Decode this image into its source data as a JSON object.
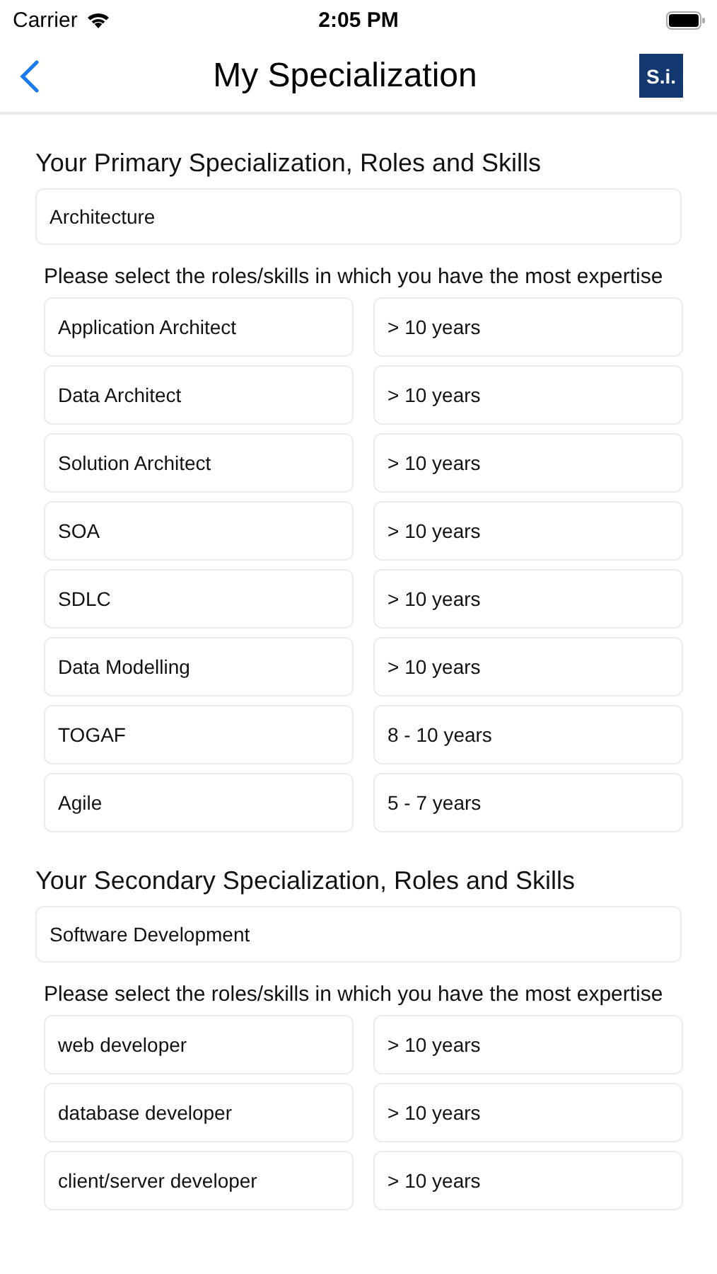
{
  "status_bar": {
    "carrier": "Carrier",
    "time": "2:05 PM"
  },
  "nav": {
    "title": "My Specialization",
    "logo": "S.i."
  },
  "sections": [
    {
      "heading": "Your Primary Specialization, Roles and Skills",
      "specialization": "Architecture",
      "note": "Please select the roles/skills in which you have the most expertise",
      "skills": [
        {
          "skill": "Application Architect",
          "experience": "> 10 years"
        },
        {
          "skill": "Data Architect",
          "experience": "> 10 years"
        },
        {
          "skill": "Solution Architect",
          "experience": "> 10 years"
        },
        {
          "skill": "SOA",
          "experience": "> 10 years"
        },
        {
          "skill": "SDLC",
          "experience": "> 10 years"
        },
        {
          "skill": "Data Modelling",
          "experience": "> 10 years"
        },
        {
          "skill": "TOGAF",
          "experience": "8 - 10 years"
        },
        {
          "skill": "Agile",
          "experience": "5 - 7 years"
        }
      ]
    },
    {
      "heading": "Your Secondary Specialization, Roles and Skills",
      "specialization": "Software Development",
      "note": "Please select the roles/skills in which you have the most expertise",
      "skills": [
        {
          "skill": "web developer",
          "experience": "> 10 years"
        },
        {
          "skill": "database developer",
          "experience": "> 10 years"
        },
        {
          "skill": "client/server developer",
          "experience": "> 10 years"
        }
      ]
    }
  ]
}
